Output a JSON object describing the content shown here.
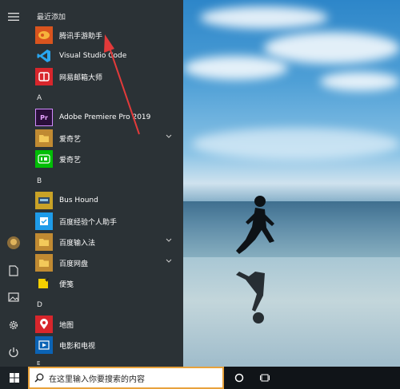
{
  "start_menu": {
    "section_recent": "最近添加",
    "recent": [
      {
        "label": "腾讯手游助手",
        "icon": "tencent-mobile-game-assistant-icon",
        "color": "#e04a1c"
      },
      {
        "label": "Visual Studio Code",
        "icon": "vscode-icon",
        "color": "#2b3236"
      },
      {
        "label": "网易邮箱大师",
        "icon": "netease-mail-master-icon",
        "color": "#d8262c"
      }
    ],
    "section_a": "A",
    "a_items": [
      {
        "label": "Adobe Premiere Pro 2019",
        "icon": "premiere-pro-icon",
        "color": "#2a0f3a"
      },
      {
        "label": "爱奇艺",
        "icon": "folder-icon",
        "color": "#e9b64a"
      },
      {
        "label": "爱奇艺",
        "icon": "iqiyi-icon",
        "color": "#00be06"
      }
    ],
    "section_b": "B",
    "b_items": [
      {
        "label": "Bus Hound",
        "icon": "bus-hound-icon",
        "color": "#c9a227"
      },
      {
        "label": "百度经验个人助手",
        "icon": "baidu-experience-icon",
        "color": "#1e9be9"
      },
      {
        "label": "百度输入法",
        "icon": "folder-icon",
        "color": "#e9b64a"
      },
      {
        "label": "百度网盘",
        "icon": "folder-icon",
        "color": "#e9b64a"
      },
      {
        "label": "便笺",
        "icon": "sticky-notes-icon",
        "color": "#f5d000"
      }
    ],
    "section_d": "D",
    "d_items": [
      {
        "label": "地图",
        "icon": "maps-icon",
        "color": "#d8262c"
      },
      {
        "label": "电影和电视",
        "icon": "movies-tv-icon",
        "color": "#0b63b5"
      }
    ],
    "section_e": "E"
  },
  "taskbar": {
    "search_placeholder": "在这里输入你要搜索的内容"
  }
}
